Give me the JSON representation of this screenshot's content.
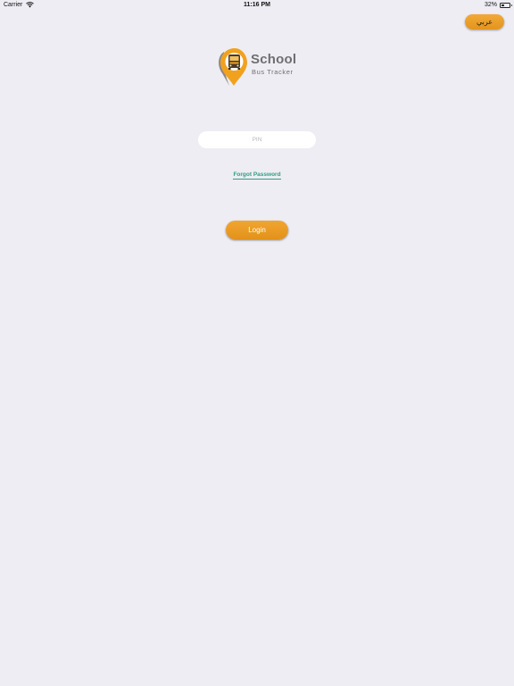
{
  "status_bar": {
    "carrier": "Carrier",
    "time": "11:16 PM",
    "battery_percent": "32%",
    "battery_level": 0.32
  },
  "language_button": {
    "label": "عربي"
  },
  "logo": {
    "title": "School",
    "subtitle": "Bus Tracker"
  },
  "login_form": {
    "pin_placeholder": "PIN",
    "pin_value": "",
    "forgot_password_label": "Forgot Password",
    "login_label": "Login"
  },
  "colors": {
    "background": "#eeedf3",
    "accent_orange": "#e99c25",
    "link_green": "#2f9e82",
    "logo_gray": "#6f6f72"
  }
}
